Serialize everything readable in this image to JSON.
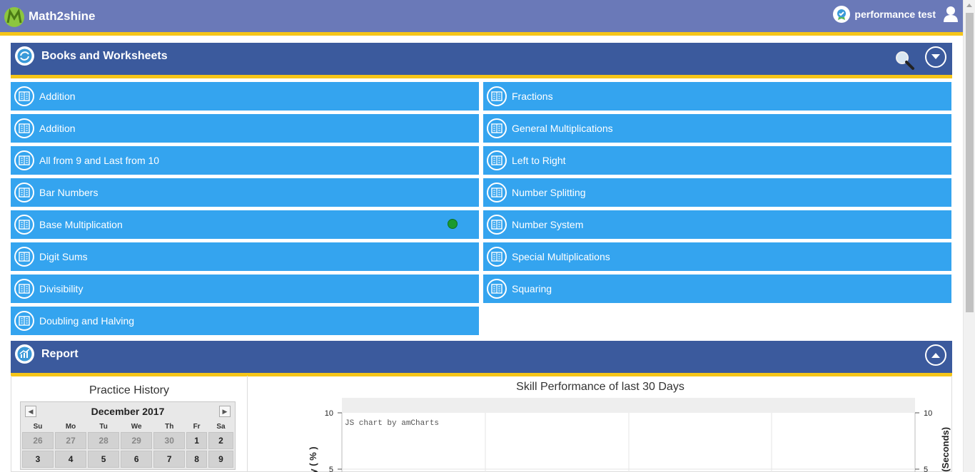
{
  "header": {
    "brand": "Math2shine",
    "user_name": "performance test"
  },
  "books_section": {
    "title": "Books and Worksheets",
    "left_items": [
      {
        "label": "Addition"
      },
      {
        "label": "Addition"
      },
      {
        "label": "All from 9 and Last from 10"
      },
      {
        "label": "Bar Numbers"
      },
      {
        "label": "Base Multiplication",
        "status": "green"
      },
      {
        "label": "Digit Sums"
      },
      {
        "label": "Divisibility"
      },
      {
        "label": "Doubling and Halving"
      }
    ],
    "right_items": [
      {
        "label": "Fractions"
      },
      {
        "label": "General Multiplications"
      },
      {
        "label": "Left to Right"
      },
      {
        "label": "Number Splitting"
      },
      {
        "label": "Number System"
      },
      {
        "label": "Special Multiplications"
      },
      {
        "label": "Squaring"
      }
    ]
  },
  "report_section": {
    "title": "Report"
  },
  "practice_history": {
    "title": "Practice History",
    "calendar": {
      "month": "December 2017",
      "prev": "◀",
      "next": "▶",
      "weekdays": [
        "Su",
        "Mo",
        "Tu",
        "We",
        "Th",
        "Fr",
        "Sa"
      ],
      "weeks": [
        [
          "26",
          "27",
          "28",
          "29",
          "30",
          "1",
          "2"
        ],
        [
          "3",
          "4",
          "5",
          "6",
          "7",
          "8",
          "9"
        ]
      ],
      "other_month_days": [
        "26",
        "27",
        "28",
        "29",
        "30"
      ]
    }
  },
  "skill_chart": {
    "title": "Skill Performance of last 30 Days",
    "credit": "JS chart by amCharts"
  },
  "chart_data": {
    "type": "line",
    "title": "Skill Performance of last 30 Days",
    "ylabel": "...racy ( % )",
    "y2label": "...me (Seconds)",
    "ylim": [
      0,
      10
    ],
    "y_ticks": [
      "10",
      "5"
    ],
    "y2_ticks": [
      "10",
      "5"
    ],
    "series": []
  },
  "colors": {
    "header": "#6a79b8",
    "section": "#3b5a9d",
    "tile": "#34a4ef",
    "accent": "#f5c518",
    "status_green": "#1b9a2e"
  }
}
